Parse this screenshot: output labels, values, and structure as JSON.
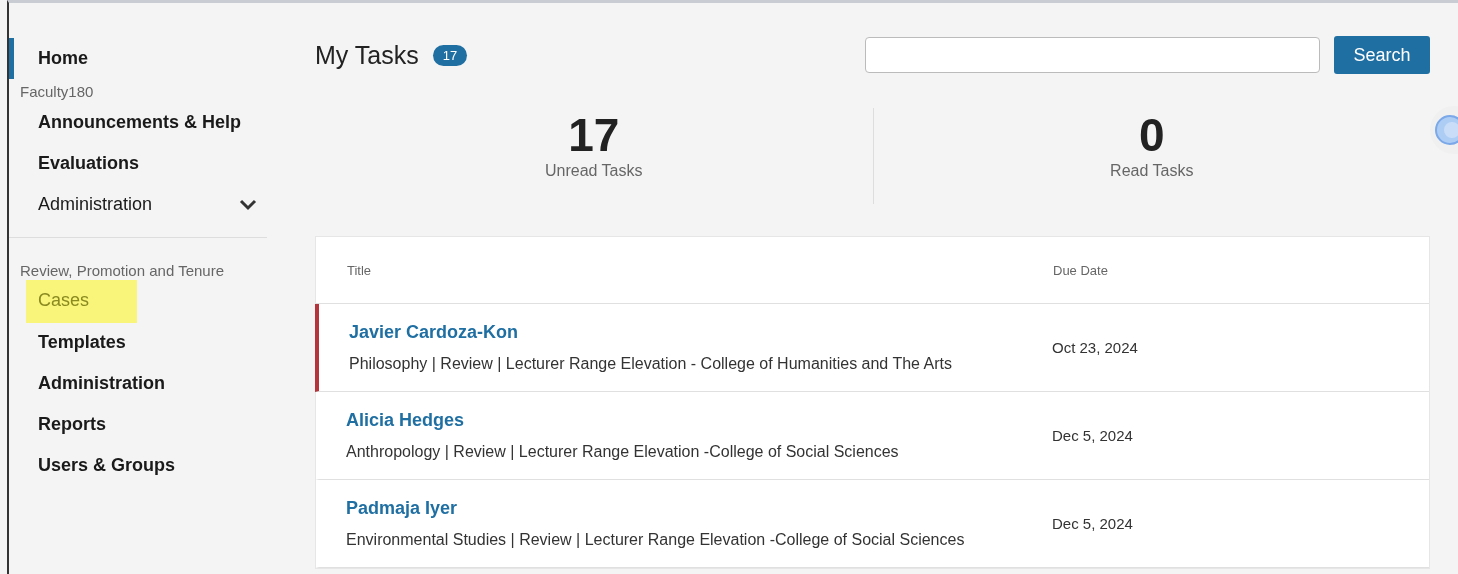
{
  "sidebar": {
    "groups": [
      {
        "items": [
          {
            "label": "Home",
            "selected": true,
            "highlighted": false,
            "bold": true
          }
        ]
      },
      {
        "heading": "Faculty180",
        "items": [
          {
            "label": "Announcements & Help",
            "selected": false,
            "highlighted": false,
            "bold": true
          },
          {
            "label": "Evaluations",
            "selected": false,
            "highlighted": false,
            "bold": true
          },
          {
            "label": "Administration",
            "selected": false,
            "highlighted": false,
            "bold": false,
            "expanded": false
          }
        ]
      },
      {
        "heading": "Review, Promotion and Tenure",
        "items": [
          {
            "label": "Cases",
            "selected": false,
            "highlighted": true,
            "bold": false
          },
          {
            "label": "Templates",
            "selected": false,
            "highlighted": false,
            "bold": true
          },
          {
            "label": "Administration",
            "selected": false,
            "highlighted": false,
            "bold": true
          },
          {
            "label": "Reports",
            "selected": false,
            "highlighted": false,
            "bold": true
          },
          {
            "label": "Users & Groups",
            "selected": false,
            "highlighted": false,
            "bold": true
          }
        ]
      }
    ]
  },
  "header": {
    "title": "My Tasks",
    "count": "17"
  },
  "search": {
    "button": "Search"
  },
  "stats": [
    {
      "value": "17",
      "label": "Unread Tasks"
    },
    {
      "value": "0",
      "label": "Read Tasks"
    }
  ],
  "table": {
    "columns": [
      "Title",
      "Due Date"
    ],
    "rows": [
      {
        "name": "Javier Cardoza-Kon",
        "details": "Philosophy | Review | Lecturer Range Elevation - College of Humanities and The Arts",
        "due": "Oct 23, 2024",
        "flagged": true
      },
      {
        "name": "Alicia Hedges",
        "details": "Anthropology | Review | Lecturer Range Elevation -College of Social Sciences",
        "due": "Dec 5, 2024",
        "flagged": false
      },
      {
        "name": "Padmaja Iyer",
        "details": "Environmental Studies | Review | Lecturer Range Elevation -College of Social Sciences",
        "due": "Dec 5, 2024",
        "flagged": false
      }
    ]
  }
}
